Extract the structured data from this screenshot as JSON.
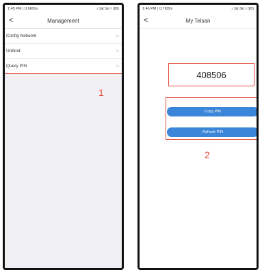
{
  "left_phone": {
    "status": {
      "time": "1:45 PM | 0.6KB/s",
      "right": "♪ 3al 3al ≈ (80)"
    },
    "nav": {
      "back": "<",
      "title": "Management"
    },
    "menu": [
      {
        "label": "Config Network",
        "chevron": ">"
      },
      {
        "label": "Unbind",
        "chevron": ">"
      },
      {
        "label": "Query PIN",
        "chevron": ">"
      }
    ],
    "annotation": "1"
  },
  "right_phone": {
    "status": {
      "time": "1:46 PM | 0.7KB/s",
      "right": "♪ 3al 3al ≈ (80)"
    },
    "nav": {
      "back": "<",
      "title": "My Telsan"
    },
    "pin": "408506",
    "buttons": {
      "copy": "Copy PIN",
      "refresh": "Refresh PIN"
    },
    "annotation": "2"
  },
  "colors": {
    "accent_red": "#e54a3b",
    "button_blue": "#3b86d8"
  }
}
